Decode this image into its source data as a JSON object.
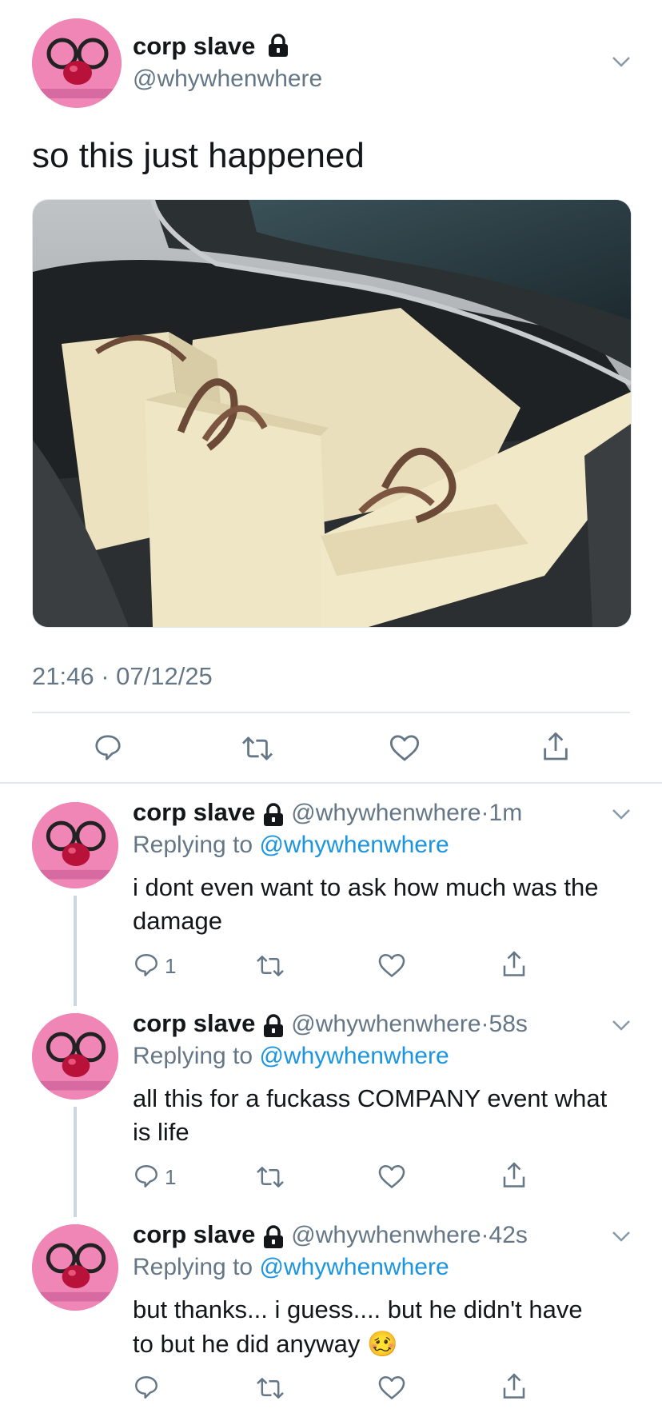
{
  "main_tweet": {
    "display_name": "corp slave",
    "handle": "@whywhenwhere",
    "text": "so this just happened",
    "timestamp": "21:46 · 07/12/25"
  },
  "replies": [
    {
      "display_name": "corp slave",
      "handle": "@whywhenwhere",
      "time": "1m",
      "replying_to_prefix": "Replying to",
      "replying_to_handle": "@whywhenwhere",
      "text_line1": "i dont even want to ask how much was the",
      "text_line2": "damage",
      "reply_count": "1"
    },
    {
      "display_name": "corp slave",
      "handle": "@whywhenwhere",
      "time": "58s",
      "replying_to_prefix": "Replying to",
      "replying_to_handle": "@whywhenwhere",
      "text_line1": "all this for a fuckass COMPANY event what",
      "text_line2": "is life",
      "reply_count": "1"
    },
    {
      "display_name": "corp slave",
      "handle": "@whywhenwhere",
      "time": "42s",
      "replying_to_prefix": "Replying to",
      "replying_to_handle": "@whywhenwhere",
      "text_line1": "but thanks... i guess.... but he didn't have",
      "text_line2": "to but he did anyway",
      "emoji": "🥴",
      "reply_count": ""
    }
  ],
  "colors": {
    "link": "#1b95e0",
    "secondary": "#657786",
    "divider": "#e1e8ed"
  }
}
